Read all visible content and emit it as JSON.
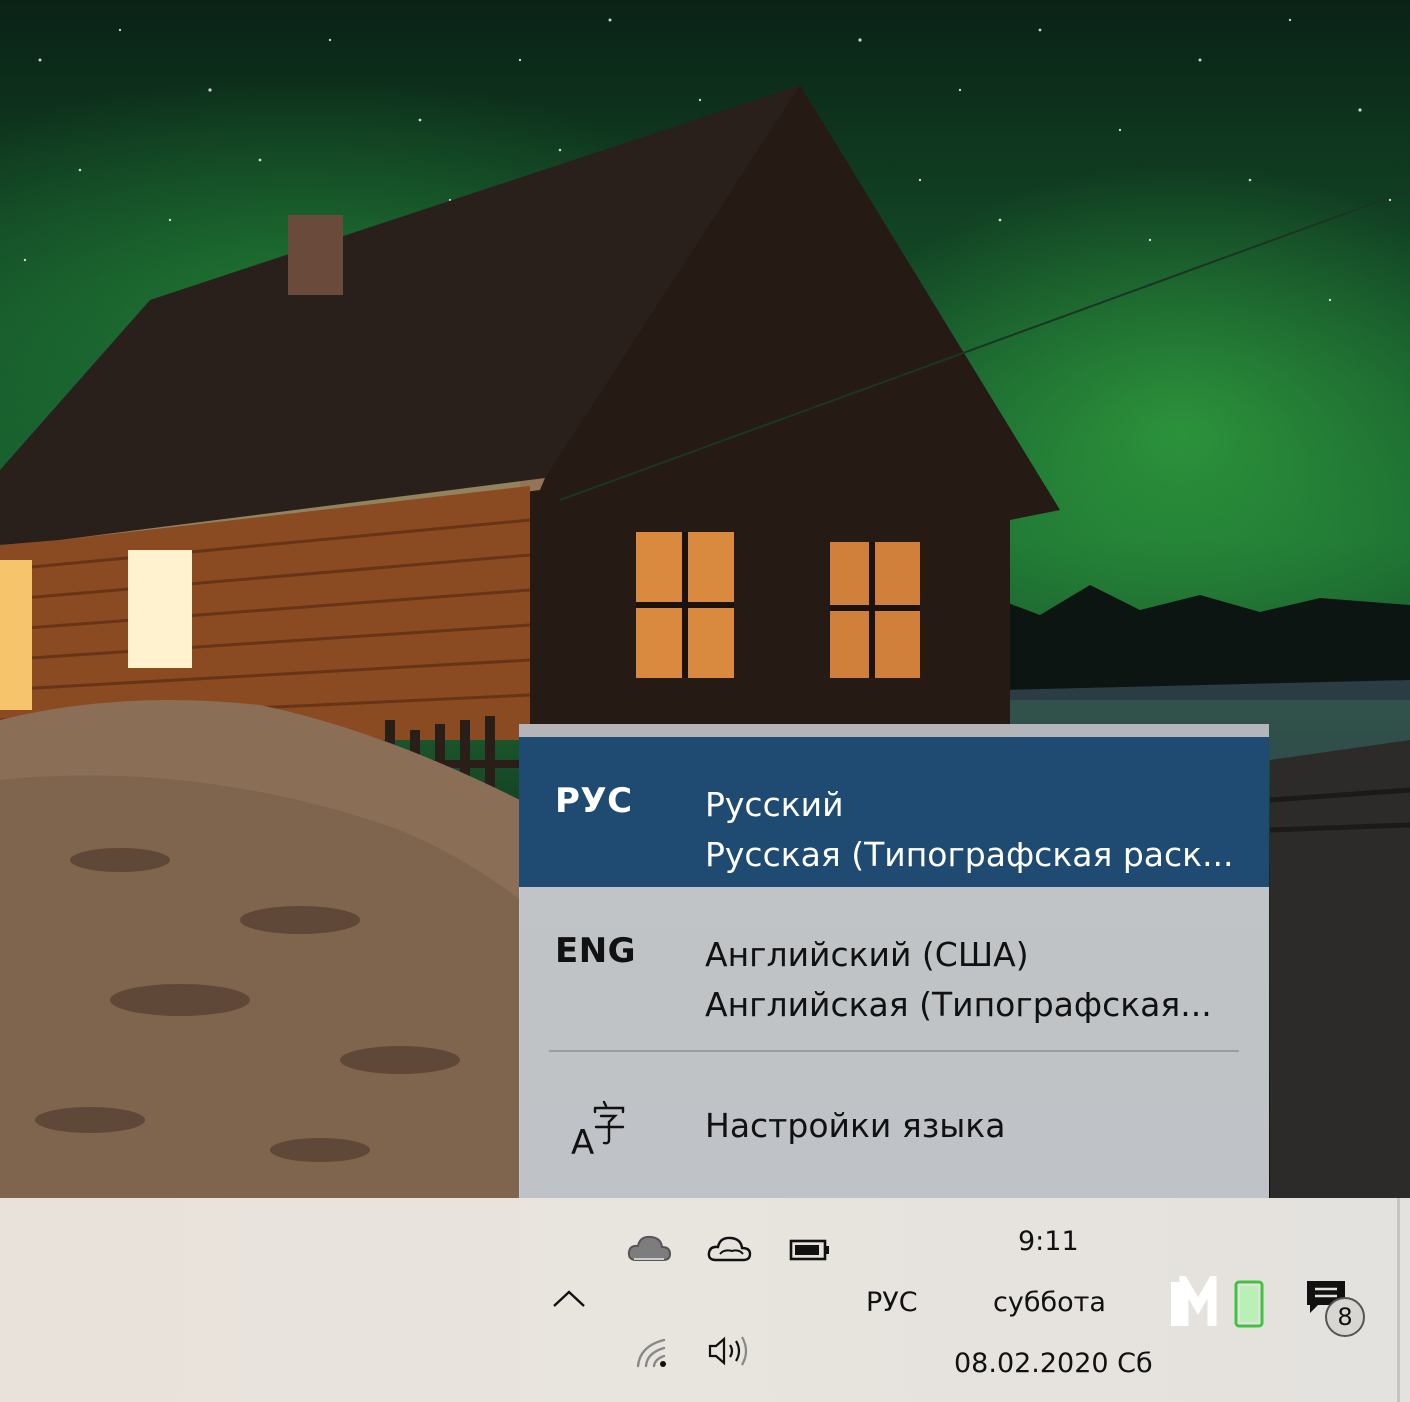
{
  "flyout": {
    "languages": [
      {
        "code": "РУС",
        "name": "Русский",
        "layout": "Русская (Типографская раск...",
        "selected": true
      },
      {
        "code": "ENG",
        "name": "Английский (США)",
        "layout": "Английская (Типографская...",
        "selected": false
      }
    ],
    "settings": {
      "icon": "language-settings-icon",
      "label": "Настройки языка"
    },
    "accent_color": "#1f4b73"
  },
  "taskbar": {
    "time": "9:11",
    "weekday": "суббота",
    "date": "08.02.2020 Сб",
    "input_indicator": "РУС",
    "notification_count": "8",
    "tray_icons": [
      "show-hidden-icons-chevron",
      "onedrive-cloud-icon",
      "onedrive-cloud-icon",
      "battery-icon",
      "wifi-icon",
      "volume-icon",
      "app-logo-icon",
      "action-center-icon"
    ]
  }
}
